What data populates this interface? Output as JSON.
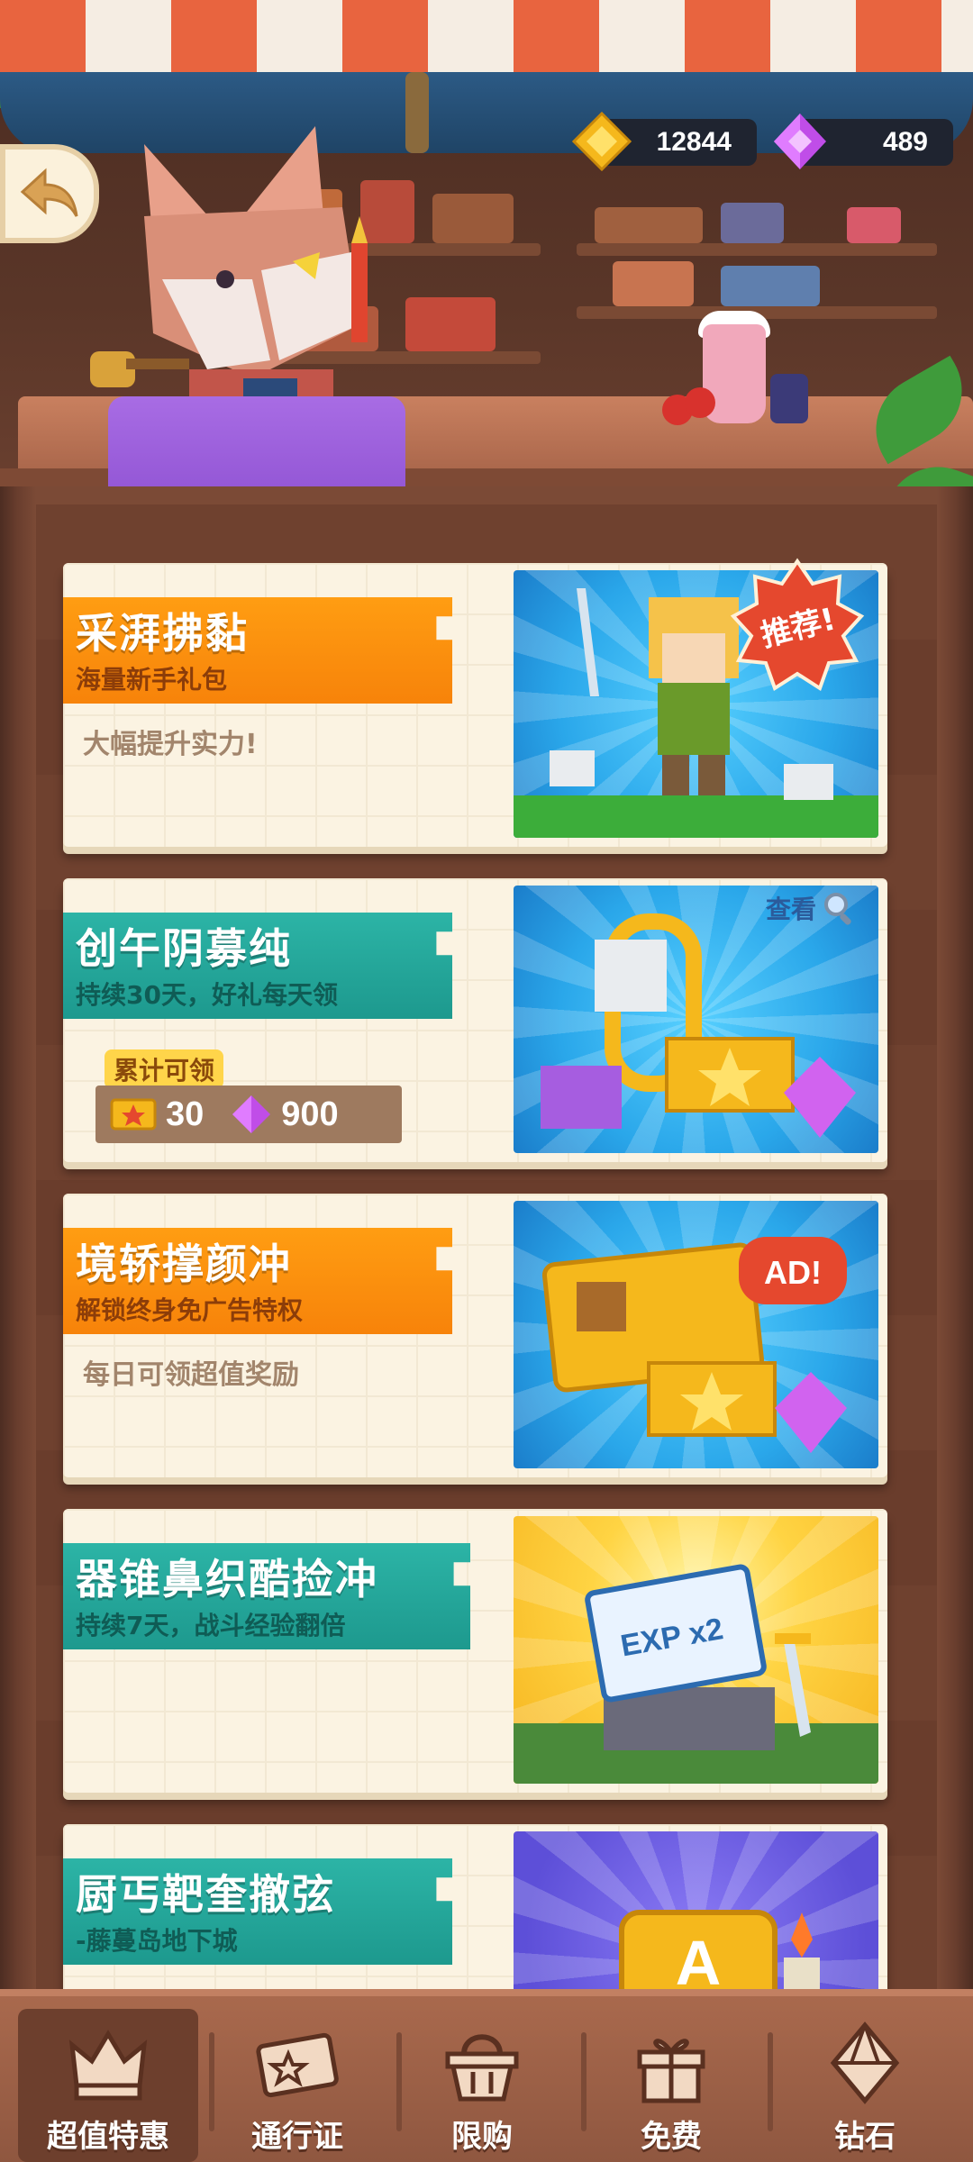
{
  "currency": {
    "gold": "12844",
    "gems": "489"
  },
  "cards": [
    {
      "title": "采湃拂黏",
      "subtitle": "海量新手礼包",
      "desc": "大幅提升实力!",
      "badge": "推荐!"
    },
    {
      "title": "创午阴募纯",
      "subtitle": "持续30天，好礼每天领",
      "view_label": "查看",
      "accumulate_label": "累计可领",
      "reward_tickets": "30",
      "reward_gems": "900"
    },
    {
      "title": "境轿撑颜冲",
      "subtitle": "解锁终身免广告特权",
      "desc": "每日可领超值奖励",
      "art_text": "AD!"
    },
    {
      "title": "器锥鼻织酷捡冲",
      "subtitle": "持续7天，战斗经验翻倍",
      "art_text": "EXP x2"
    },
    {
      "title": "厨丐靶奎撤弦",
      "subtitle": "-藤蔓岛地下城"
    }
  ],
  "nav": [
    {
      "label": "超值特惠",
      "icon": "crown-icon",
      "active": true
    },
    {
      "label": "通行证",
      "icon": "pass-ticket-icon"
    },
    {
      "label": "限购",
      "icon": "basket-icon"
    },
    {
      "label": "免费",
      "icon": "gift-icon"
    },
    {
      "label": "钻石",
      "icon": "diamond-icon"
    }
  ],
  "colors": {
    "accent_orange": "#f7830a",
    "accent_teal": "#1d998e",
    "wood": "#7b4a36",
    "card_bg": "#fbf3e2"
  }
}
